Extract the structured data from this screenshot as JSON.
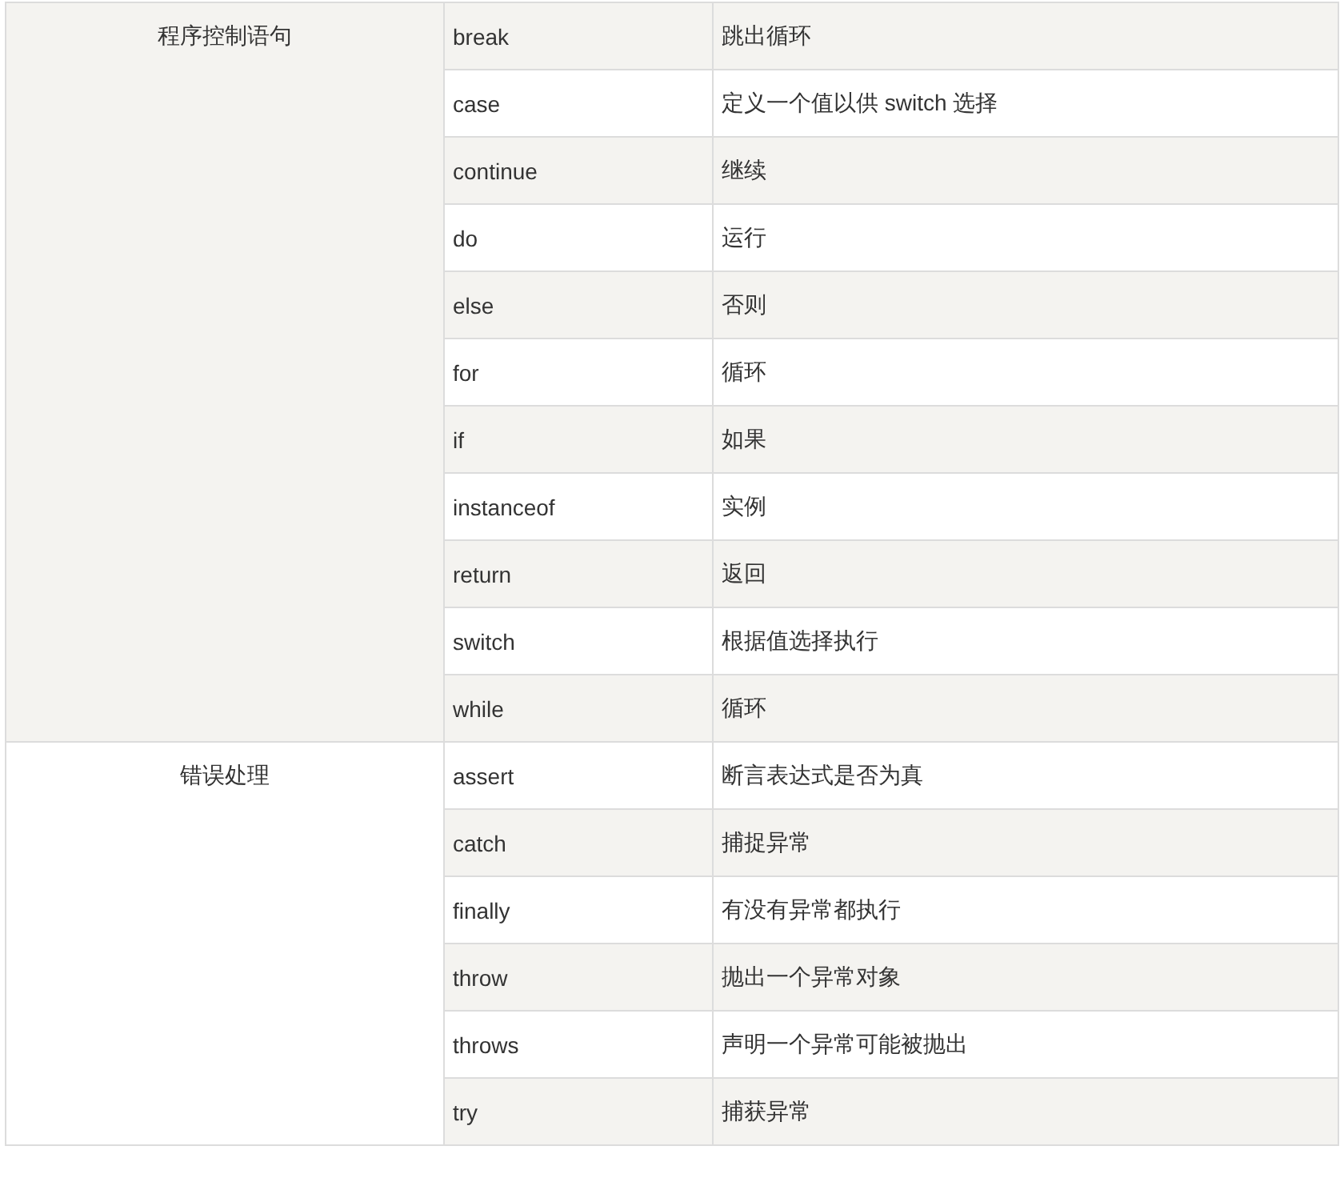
{
  "table": {
    "groups": [
      {
        "column_1": "程序控制语句",
        "rows": [
          {
            "column_2": "break",
            "column_3": "跳出循环"
          },
          {
            "column_2": "case",
            "column_3": "定义一个值以供 switch 选择"
          },
          {
            "column_2": "continue",
            "column_3": "继续"
          },
          {
            "column_2": "do",
            "column_3": "运行"
          },
          {
            "column_2": "else",
            "column_3": "否则"
          },
          {
            "column_2": "for",
            "column_3": "循环"
          },
          {
            "column_2": "if",
            "column_3": "如果"
          },
          {
            "column_2": "instanceof",
            "column_3": "实例"
          },
          {
            "column_2": "return",
            "column_3": "返回"
          },
          {
            "column_2": "switch",
            "column_3": "根据值选择执行"
          },
          {
            "column_2": "while",
            "column_3": "循环"
          }
        ]
      },
      {
        "column_1": "错误处理",
        "rows": [
          {
            "column_2": "assert",
            "column_3": "断言表达式是否为真"
          },
          {
            "column_2": "catch",
            "column_3": "捕捉异常"
          },
          {
            "column_2": "finally",
            "column_3": "有没有异常都执行"
          },
          {
            "column_2": "throw",
            "column_3": "抛出一个异常对象"
          },
          {
            "column_2": "throws",
            "column_3": "声明一个异常可能被抛出"
          },
          {
            "column_2": "try",
            "column_3": "捕获异常"
          }
        ]
      }
    ]
  }
}
